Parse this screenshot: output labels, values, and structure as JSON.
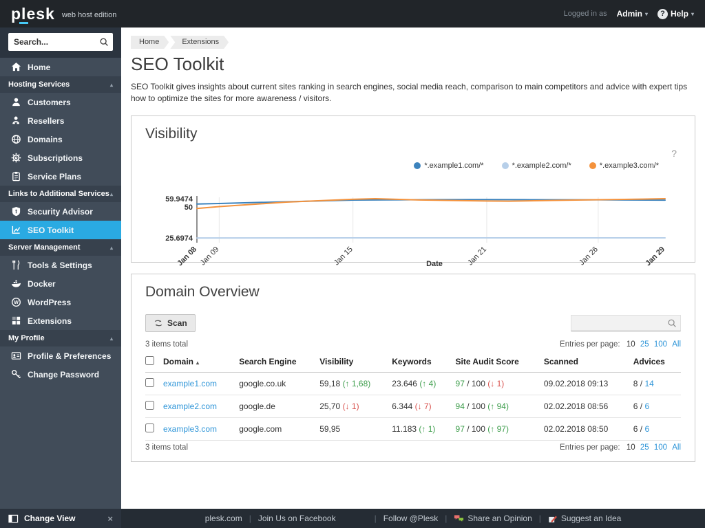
{
  "topbar": {
    "logo_text": "plesk",
    "logo_suffix": "web host edition",
    "logged_in_label": "Logged in as",
    "user_name": "Admin",
    "help_label": "Help"
  },
  "icons": {
    "caret_down": "▾",
    "section_caret": "▴",
    "sort_caret": "▲",
    "close": "×",
    "help": "?"
  },
  "sidebar": {
    "search_placeholder": "Search...",
    "home_label": "Home",
    "sections": [
      {
        "label": "Hosting Services",
        "items": [
          {
            "label": "Customers"
          },
          {
            "label": "Resellers"
          },
          {
            "label": "Domains"
          },
          {
            "label": "Subscriptions"
          },
          {
            "label": "Service Plans"
          }
        ]
      },
      {
        "label": "Links to Additional Services",
        "items": [
          {
            "label": "Security Advisor"
          },
          {
            "label": "SEO Toolkit"
          }
        ]
      },
      {
        "label": "Server Management",
        "items": [
          {
            "label": "Tools & Settings"
          },
          {
            "label": "Docker"
          },
          {
            "label": "WordPress"
          },
          {
            "label": "Extensions"
          }
        ]
      },
      {
        "label": "My Profile",
        "items": [
          {
            "label": "Profile & Preferences"
          },
          {
            "label": "Change Password"
          }
        ]
      }
    ],
    "change_view_label": "Change View"
  },
  "breadcrumb": {
    "items": [
      "Home",
      "Extensions"
    ]
  },
  "page": {
    "title": "SEO Toolkit",
    "description": "SEO Toolkit gives insights about current sites ranking in search engines, social media reach, comparison to main competitors and advice with expert tips how to optimize the sites for more awareness / visitors."
  },
  "visibility_panel": {
    "title": "Visibility"
  },
  "chart_data": {
    "type": "line",
    "title": "Visibility",
    "xlabel": "Date",
    "ylabel": "",
    "ylim": [
      25.6974,
      59.9474
    ],
    "grid": "vertical",
    "legend_position": "top-right",
    "x_ticks": [
      {
        "day": 8,
        "label": "Jan 08"
      },
      {
        "day": 9,
        "label": "Jan 09"
      },
      {
        "day": 15,
        "label": "Jan 15"
      },
      {
        "day": 21,
        "label": "Jan 21"
      },
      {
        "day": 26,
        "label": "Jan 26"
      },
      {
        "day": 29,
        "label": "Jan 29"
      }
    ],
    "gridline_days": [
      9,
      15,
      21,
      26
    ],
    "y_ticks": [
      {
        "value": 59.9474,
        "label": "59.9474"
      },
      {
        "value": 50,
        "label": "50"
      },
      {
        "value": 25.6974,
        "label": "25.6974"
      }
    ],
    "series": [
      {
        "name": "*.example1.com/*",
        "color": "#3c83bd",
        "points": [
          [
            8,
            53.5
          ],
          [
            9,
            54.2
          ],
          [
            12,
            56.3
          ],
          [
            15,
            58.3
          ],
          [
            18,
            58.8
          ],
          [
            21,
            59.0
          ],
          [
            23,
            58.8
          ],
          [
            26,
            58.6
          ],
          [
            29,
            58.2
          ]
        ]
      },
      {
        "name": "*.example2.com/*",
        "color": "#b7cfe9",
        "points": [
          [
            8,
            25.55
          ],
          [
            12,
            25.62
          ],
          [
            15,
            25.66
          ],
          [
            21,
            25.7
          ],
          [
            26,
            25.7
          ],
          [
            29,
            25.7
          ]
        ]
      },
      {
        "name": "*.example3.com/*",
        "color": "#f4923c",
        "points": [
          [
            8,
            48.8
          ],
          [
            9,
            50.4
          ],
          [
            12,
            55.8
          ],
          [
            15,
            59.3
          ],
          [
            16,
            59.95
          ],
          [
            18,
            58.4
          ],
          [
            21,
            57.2
          ],
          [
            22,
            57.0
          ],
          [
            24,
            57.9
          ],
          [
            26,
            58.7
          ],
          [
            28,
            59.5
          ],
          [
            29,
            59.95
          ]
        ]
      }
    ]
  },
  "domain_panel": {
    "title": "Domain Overview",
    "scan_label": "Scan",
    "items_total": "3 items total",
    "entries_label": "Entries per page:",
    "entries_options": [
      "10",
      "25",
      "100",
      "All"
    ],
    "search_placeholder": "",
    "headers": [
      "Domain",
      "Search Engine",
      "Visibility",
      "Keywords",
      "Site Audit Score",
      "Scanned",
      "Advices"
    ],
    "advices_sep": "/",
    "rows": [
      {
        "domain": "example1.com",
        "search_engine": "google.co.uk",
        "visibility": "59,18",
        "visibility_delta": "(↑ 1,68)",
        "visibility_dir": "up",
        "keywords": "23.646",
        "keywords_delta": "(↑ 4)",
        "keywords_dir": "up",
        "audit_score": "97",
        "audit_total": "/ 100",
        "audit_delta": "(↓ 1)",
        "audit_dir": "down",
        "scanned": "09.02.2018 09:13",
        "advices_done": "8",
        "advices_total": "14"
      },
      {
        "domain": "example2.com",
        "search_engine": "google.de",
        "visibility": "25,70",
        "visibility_delta": "(↓ 1)",
        "visibility_dir": "down",
        "keywords": "6.344",
        "keywords_delta": "(↓ 7)",
        "keywords_dir": "down",
        "audit_score": "94",
        "audit_total": "/ 100",
        "audit_delta": "(↑ 94)",
        "audit_dir": "up",
        "scanned": "02.02.2018 08:56",
        "advices_done": "6",
        "advices_total": "6"
      },
      {
        "domain": "example3.com",
        "search_engine": "google.com",
        "visibility": "59,95",
        "visibility_delta": "",
        "visibility_dir": "",
        "keywords": "11.183",
        "keywords_delta": "(↑ 1)",
        "keywords_dir": "up",
        "audit_score": "97",
        "audit_total": "/ 100",
        "audit_delta": "(↑ 97)",
        "audit_dir": "up",
        "scanned": "02.02.2018 08:50",
        "advices_done": "6",
        "advices_total": "6"
      }
    ]
  },
  "footer": {
    "sep": "|",
    "links": [
      "plesk.com",
      "Join Us on Facebook",
      "Follow @Plesk",
      "Share an Opinion",
      "Suggest an Idea"
    ]
  }
}
